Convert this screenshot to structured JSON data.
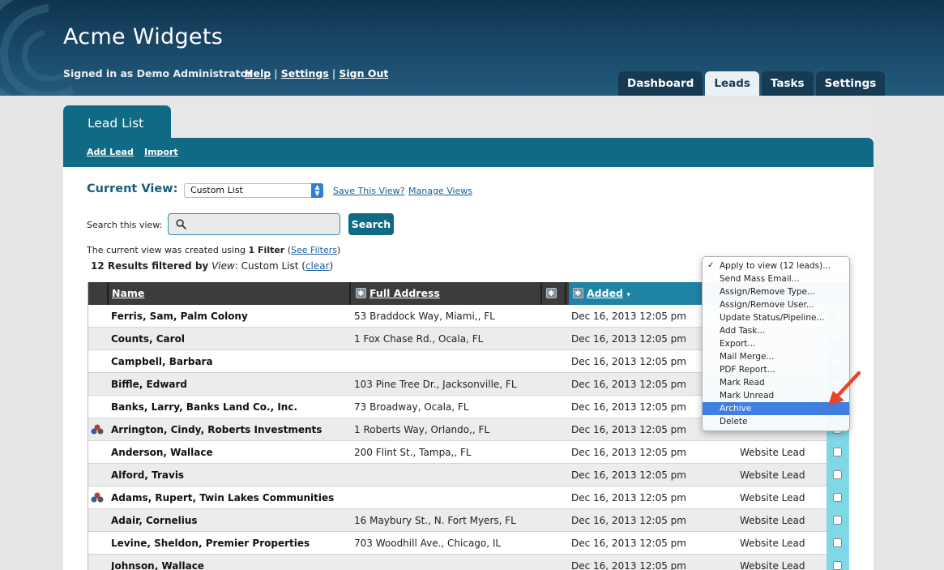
{
  "app": {
    "title": "Acme Widgets",
    "signed_in": "Signed in as Demo Administrator",
    "links": [
      "Help",
      "Settings",
      "Sign Out"
    ],
    "link_separator": "|"
  },
  "nav": {
    "tabs": [
      {
        "label": "Dashboard",
        "active": false
      },
      {
        "label": "Leads",
        "active": true
      },
      {
        "label": "Tasks",
        "active": false
      },
      {
        "label": "Settings",
        "active": false
      }
    ]
  },
  "panel": {
    "tab_title": "Lead List",
    "subnav": [
      "Add Lead",
      "Import"
    ]
  },
  "view": {
    "label": "Current View:",
    "selected": "Custom List",
    "save_link": "Save This View?",
    "manage_link": "Manage Views"
  },
  "search": {
    "label": "Search this view:",
    "value": "",
    "button": "Search"
  },
  "filter": {
    "prefix": "The current view was created using",
    "count": "1 Filter",
    "link": "See Filters"
  },
  "results": {
    "count": "12 Results filtered by",
    "view_word": "View",
    "view_name": ": Custom List (",
    "clear": "clear",
    "close": ")"
  },
  "table": {
    "columns": {
      "name": "Name",
      "address": "Full Address",
      "added": "Added",
      "sort_indicator": "▾"
    },
    "rows": [
      {
        "name": "Ferris, Sam, Palm Colony",
        "address": "53 Braddock Way, Miami,, FL",
        "added": "Dec 16, 2013 12:05 pm",
        "type": "",
        "icon": false
      },
      {
        "name": "Counts, Carol",
        "address": "1 Fox Chase Rd., Ocala, FL",
        "added": "Dec 16, 2013 12:05 pm",
        "type": "",
        "icon": false
      },
      {
        "name": "Campbell, Barbara",
        "address": "",
        "added": "Dec 16, 2013 12:05 pm",
        "type": "",
        "icon": false
      },
      {
        "name": "Biffle, Edward",
        "address": "103 Pine Tree Dr., Jacksonville, FL",
        "added": "Dec 16, 2013 12:05 pm",
        "type": "",
        "icon": false
      },
      {
        "name": "Banks, Larry, Banks Land Co., Inc.",
        "address": "73 Broadway, Ocala, FL",
        "added": "Dec 16, 2013 12:05 pm",
        "type": "",
        "icon": false
      },
      {
        "name": "Arrington, Cindy, Roberts Investments",
        "address": "1 Roberts Way, Orlando,, FL",
        "added": "Dec 16, 2013 12:05 pm",
        "type": "",
        "icon": true
      },
      {
        "name": "Anderson, Wallace",
        "address": "200 Flint St., Tampa,, FL",
        "added": "Dec 16, 2013 12:05 pm",
        "type": "Website Lead",
        "icon": false
      },
      {
        "name": "Alford, Travis",
        "address": "",
        "added": "Dec 16, 2013 12:05 pm",
        "type": "Website Lead",
        "icon": false
      },
      {
        "name": "Adams, Rupert, Twin Lakes Communities",
        "address": "",
        "added": "Dec 16, 2013 12:05 pm",
        "type": "Website Lead",
        "icon": true
      },
      {
        "name": "Adair, Cornelius",
        "address": "16 Maybury St., N. Fort Myers, FL",
        "added": "Dec 16, 2013 12:05 pm",
        "type": "Website Lead",
        "icon": false
      },
      {
        "name": "Levine, Sheldon, Premier Properties",
        "address": "703 Woodhill Ave., Chicago, IL",
        "added": "Dec 16, 2013 12:05 pm",
        "type": "Website Lead",
        "icon": false
      },
      {
        "name": "Johnson, Wallace",
        "address": "",
        "added": "Dec 16, 2013 12:05 pm",
        "type": "Website Lead",
        "icon": false
      }
    ]
  },
  "menu": {
    "items": [
      {
        "label": "Apply to view (12 leads)...",
        "checked": true,
        "selected": false
      },
      {
        "label": "Send Mass Email...",
        "checked": false,
        "selected": false
      },
      {
        "label": "Assign/Remove Type...",
        "checked": false,
        "selected": false
      },
      {
        "label": "Assign/Remove User...",
        "checked": false,
        "selected": false
      },
      {
        "label": "Update Status/Pipeline...",
        "checked": false,
        "selected": false
      },
      {
        "label": "Add Task...",
        "checked": false,
        "selected": false
      },
      {
        "label": "Export...",
        "checked": false,
        "selected": false
      },
      {
        "label": "Mail Merge...",
        "checked": false,
        "selected": false
      },
      {
        "label": "PDF Report...",
        "checked": false,
        "selected": false
      },
      {
        "label": "Mark Read",
        "checked": false,
        "selected": false
      },
      {
        "label": "Mark Unread",
        "checked": false,
        "selected": false
      },
      {
        "label": "Archive",
        "checked": false,
        "selected": true
      },
      {
        "label": "Delete",
        "checked": false,
        "selected": false
      }
    ]
  },
  "colors": {
    "header": "#1a4a6a",
    "accent": "#0f6a86",
    "added_header": "#1f83a4",
    "checkbox_column": "#7fd8e6",
    "menu_highlight": "#3e7fe1",
    "annotation_arrow": "#e8442a"
  },
  "icons": {
    "lead_icon": "contact-group-icon",
    "search": "search-icon",
    "column_options": "gear-icon",
    "annotation": "red-arrow-annotation"
  }
}
